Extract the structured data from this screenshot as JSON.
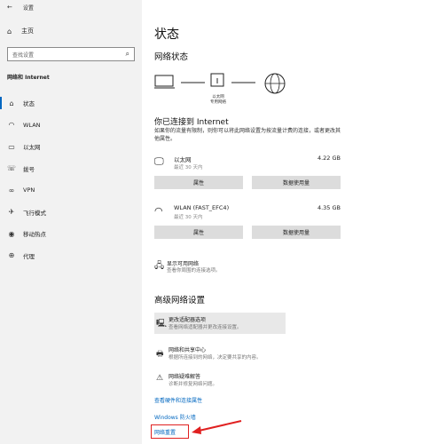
{
  "window": {
    "back_glyph": "←",
    "title": "设置"
  },
  "sidebar": {
    "home_label": "主页",
    "search_placeholder": "查找设置",
    "section_title": "网络和 Internet",
    "items": [
      {
        "label": "状态",
        "icon": "home-icon",
        "active": true
      },
      {
        "label": "WLAN",
        "icon": "wifi-icon"
      },
      {
        "label": "以太网",
        "icon": "ethernet-icon"
      },
      {
        "label": "拨号",
        "icon": "phone-icon"
      },
      {
        "label": "VPN",
        "icon": "vpn-icon"
      },
      {
        "label": "飞行模式",
        "icon": "airplane-icon"
      },
      {
        "label": "移动热点",
        "icon": "hotspot-icon"
      },
      {
        "label": "代理",
        "icon": "globe-icon"
      }
    ]
  },
  "main": {
    "title": "状态",
    "network_status_heading": "网络状态",
    "diagram_label_1": "以太网",
    "diagram_label_2": "专用网络",
    "connected_text": "你已连接到 Internet",
    "connected_desc": "如果你的流量有限制，则你可以将此网络设置为按流量计费的连接，或者更改其他属性。",
    "adapters": [
      {
        "name": "以太网",
        "sub": "最近 30 天内",
        "size": "4.22 GB",
        "btn1": "属性",
        "btn2": "数据使用量"
      },
      {
        "name": "WLAN (FAST_EFC4)",
        "sub": "最近 30 天内",
        "size": "4.35 GB",
        "btn1": "属性",
        "btn2": "数据使用量"
      }
    ],
    "show_available": {
      "title": "显示可用网络",
      "desc": "查看你周围的连接选项。"
    },
    "advanced_heading": "高级网络设置",
    "advanced_items": [
      {
        "title": "更改适配器选项",
        "desc": "查看网络适配器并更改连接设置。"
      },
      {
        "title": "网络和共享中心",
        "desc": "根据所连接到的网络，决定要共享的内容。"
      },
      {
        "title": "网络疑难解答",
        "desc": "诊断并修复网络问题。"
      }
    ],
    "link_hardware": "查看硬件和连接属性",
    "link_firewall": "Windows 防火墙",
    "link_reset": "网络重置"
  }
}
